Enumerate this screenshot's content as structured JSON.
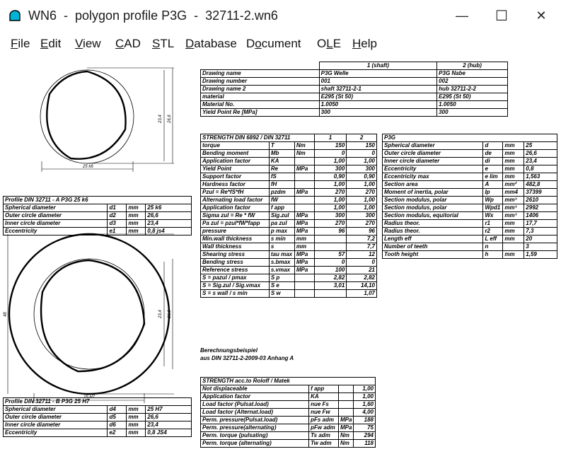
{
  "window": {
    "title": "WN6  -  polygon profile P3G  -  32711-2.wn6",
    "minimize": "—",
    "maximize": "☐",
    "close": "✕",
    "accent": "#00b4d8"
  },
  "menu": [
    {
      "u": "F",
      "rest": "ile"
    },
    {
      "u": "E",
      "rest": "dit"
    },
    {
      "u": "V",
      "rest": "iew"
    },
    {
      "u": "C",
      "rest": "AD"
    },
    {
      "u": "S",
      "rest": "TL"
    },
    {
      "u": "D",
      "rest": "atabase"
    },
    {
      "pre": "D",
      "u": "o",
      "rest": "cument"
    },
    {
      "pre": "O",
      "u": "L",
      "rest": "E"
    },
    {
      "u": "H",
      "rest": "elp"
    }
  ],
  "drawing_labels": {
    "a_dim_bottom": "25 k6",
    "a_dim_right1": "23,4",
    "a_dim_right2": "26,6",
    "b_dim_bottom": "25 H7",
    "b_dim_right1": "23,4",
    "b_dim_right2": "26,6",
    "b_dim_left": "48"
  },
  "profile_a": {
    "title": "Profile DIN 32711 - A P3G 25 k6",
    "rows": [
      [
        "Spherical diameter",
        "d1",
        "mm",
        "25 k6"
      ],
      [
        "Outer circle diameter",
        "d2",
        "mm",
        "26,6"
      ],
      [
        "Inner circle diameter",
        "d3",
        "mm",
        "23,4"
      ],
      [
        "Eccentricity",
        "e1",
        "mm",
        "0,8 js4"
      ]
    ]
  },
  "profile_b": {
    "title": "Profile DIN 32711 - B P3G 25 H7",
    "rows": [
      [
        "Spherical diameter",
        "d4",
        "mm",
        "25 H7"
      ],
      [
        "Outer circle diameter",
        "d5",
        "mm",
        "26,6"
      ],
      [
        "Inner circle diameter",
        "d6",
        "mm",
        "23,4"
      ],
      [
        "Eccentricity",
        "e2",
        "mm",
        "0,8 JS4"
      ]
    ]
  },
  "header": {
    "col1": "1 (shaft)",
    "col2": "2 (hub)",
    "rows": [
      [
        "Drawing name",
        "P3G Welle",
        "P3G Nabe"
      ],
      [
        "Drawing number",
        "001",
        "002"
      ],
      [
        "Drawing name 2",
        "shaft 32711-2-1",
        "hub 32711-2-2"
      ],
      [
        "material",
        "E295 (St 50)",
        "E295 (St 50)"
      ],
      [
        "Material No.",
        "1.0050",
        "1.0050"
      ],
      [
        "Yield Point Re [MPa]",
        "300",
        "300"
      ]
    ]
  },
  "strength": {
    "title": "STRENGTH DIN 6892 / DIN 32711",
    "c1": "1",
    "c2": "2",
    "rows": [
      [
        "torque",
        "T",
        "Nm",
        "150",
        "150"
      ],
      [
        "Bending moment",
        "Mb",
        "Nm",
        "0",
        "0"
      ],
      [
        "Application factor",
        "KA",
        "",
        "1,00",
        "1,00"
      ],
      [
        "Yield Point",
        "Re",
        "MPa",
        "300",
        "300"
      ],
      [
        "Support factor",
        "fS",
        "",
        "0,90",
        "0,90"
      ],
      [
        "Hardness factor",
        "fH",
        "",
        "1,00",
        "1,00"
      ],
      [
        "Pzul = Re*fS*fH",
        "pzdm",
        "MPa",
        "270",
        "270"
      ],
      [
        "Alternating load factor",
        "fW",
        "",
        "1,00",
        "1,00"
      ],
      [
        "Application factor",
        "f app",
        "",
        "1,00",
        "1,00"
      ],
      [
        "Sigma zul = Re * fW",
        "Sig.zul",
        "MPa",
        "300",
        "300"
      ],
      [
        "Pa zul = pzul*fW*fapp",
        "pa zul",
        "MPa",
        "270",
        "270"
      ],
      [
        "pressure",
        "p max",
        "MPa",
        "96",
        "96"
      ],
      [
        "Min.wall thickness",
        "s min",
        "mm",
        "",
        "7,2"
      ],
      [
        "Wall thickness",
        "s",
        "mm",
        "",
        "7,7"
      ],
      [
        "Shearing stress",
        "tau max",
        "MPa",
        "57",
        "12"
      ],
      [
        "Bending stress",
        "s.bmax",
        "MPa",
        "0",
        "0"
      ],
      [
        "Reference stress",
        "s.vmax",
        "MPa",
        "100",
        "21"
      ],
      [
        "S = pazul / pmax",
        "S p",
        "",
        "2,82",
        "2,82"
      ],
      [
        "S = Sig.zul / Sig.vmax",
        "S e",
        "",
        "3,01",
        "14,10"
      ],
      [
        "S = s wall / s min",
        "S w",
        "",
        "",
        "1,07"
      ]
    ]
  },
  "p3g": {
    "title": "P3G",
    "rows": [
      [
        "Spherical diameter",
        "d",
        "mm",
        "25"
      ],
      [
        "Outer circle diameter",
        "de",
        "mm",
        "26,6"
      ],
      [
        "Inner circle diameter",
        "di",
        "mm",
        "23,4"
      ],
      [
        "Eccentricity",
        "e",
        "mm",
        "0,8"
      ],
      [
        "Eccentricity max",
        "e lim",
        "mm",
        "1,563"
      ],
      [
        "Section area",
        "A",
        "mm²",
        "482,8"
      ],
      [
        "Moment of inertia, polar",
        "Ip",
        "mm4",
        "37399"
      ],
      [
        "Section modulus, polar",
        "Wp",
        "mm³",
        "2610"
      ],
      [
        "Section modulus, polar",
        "Wpd1",
        "mm³",
        "2992"
      ],
      [
        "Section modulus, equitorial",
        "Wx",
        "mm³",
        "1406"
      ],
      [
        "Radius theor.",
        "r1",
        "mm",
        "17,7"
      ],
      [
        "Radius theor.",
        "r2",
        "mm",
        "7,3"
      ],
      [
        "Length eff",
        "L eff",
        "mm",
        "20"
      ],
      [
        "Number of teeth",
        "n",
        "",
        "3"
      ],
      [
        "Tooth height",
        "h",
        "mm",
        "1,59"
      ]
    ]
  },
  "note": {
    "line1": "Berechnungsbeispiel",
    "line2": "aus DIN 32711-2-2009-03 Anhang A"
  },
  "roloff": {
    "title": "STRENGTH acc.to Roloff / Matek",
    "rows": [
      [
        "Not displaceable",
        "f app",
        "",
        "1,00"
      ],
      [
        "Application factor",
        "KA",
        "",
        "1,00"
      ],
      [
        "Load factor (Pulsat.load)",
        "nue Fs",
        "",
        "1,60"
      ],
      [
        "Load factor (Alternat.load)",
        "nue Fw",
        "",
        "4,00"
      ],
      [
        "Perm. pressure(Pulsat.load)",
        "pFs adm",
        "MPa",
        "188"
      ],
      [
        "Perm. pressure(alternating)",
        "pFw adm",
        "MPa",
        "75"
      ],
      [
        "Perm. torque (pulsating)",
        "Ts adm",
        "Nm",
        "294"
      ],
      [
        "Perm. torque (alternating)",
        "Tw adm",
        "Nm",
        "118"
      ]
    ]
  }
}
